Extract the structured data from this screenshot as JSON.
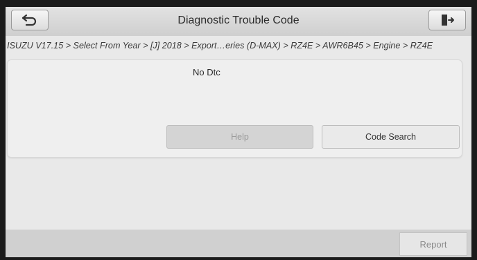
{
  "header": {
    "title": "Diagnostic Trouble Code",
    "back_icon": "back-arrow-icon",
    "exit_icon": "exit-door-icon"
  },
  "breadcrumb": {
    "text": "ISUZU V17.15 > Select From Year > [J] 2018 > Export…eries (D-MAX) > RZ4E > AWR6B45 > Engine > RZ4E"
  },
  "panel": {
    "status": "No Dtc",
    "help_label": "Help",
    "code_search_label": "Code Search"
  },
  "footer": {
    "report_label": "Report"
  }
}
